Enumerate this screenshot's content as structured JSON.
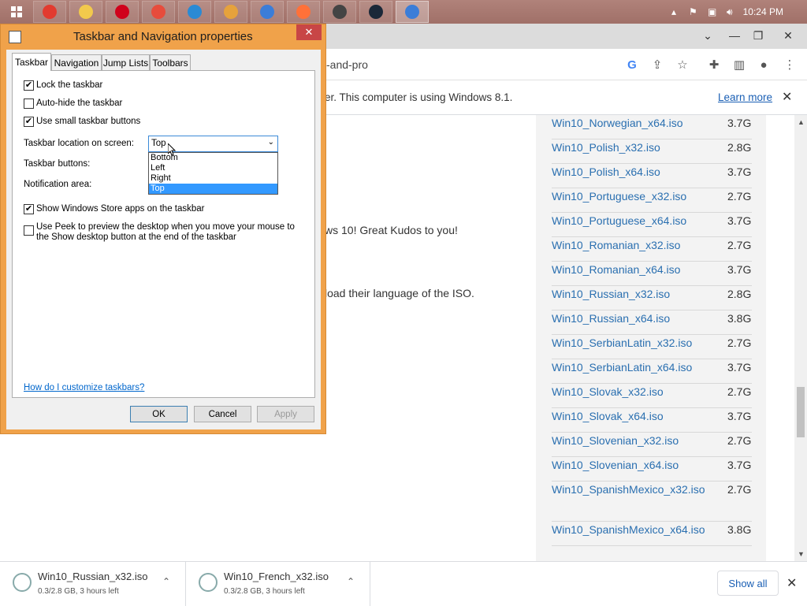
{
  "taskbar": {
    "clock": "10:24 PM",
    "apps": [
      {
        "name": "chrome",
        "color": "#e23b2f"
      },
      {
        "name": "file-explorer",
        "color": "#f2c94c"
      },
      {
        "name": "opera",
        "color": "#d0021b"
      },
      {
        "name": "alarm",
        "color": "#e74c3c"
      },
      {
        "name": "vscode",
        "color": "#2a8ad4"
      },
      {
        "name": "app-orange",
        "color": "#e6a23c"
      },
      {
        "name": "qbittorrent",
        "color": "#3b7dd8"
      },
      {
        "name": "firefox",
        "color": "#ff7139"
      },
      {
        "name": "app-dark",
        "color": "#444444"
      },
      {
        "name": "steam",
        "color": "#1b2838"
      },
      {
        "name": "taskbar-properties",
        "color": "#3b7dd8"
      }
    ]
  },
  "browser": {
    "url_fragment": "-and-pro",
    "infobar_text": "er. This computer is using Windows 8.1.",
    "learn_more": "Learn more"
  },
  "page": {
    "text1": "ws 10! Great Kudos to you!",
    "text2": "load their language of the ISO.",
    "isos": [
      {
        "name": "Win10_Norwegian_x64.iso",
        "size": "3.7G"
      },
      {
        "name": "Win10_Polish_x32.iso",
        "size": "2.8G"
      },
      {
        "name": "Win10_Polish_x64.iso",
        "size": "3.7G"
      },
      {
        "name": "Win10_Portuguese_x32.iso",
        "size": "2.7G"
      },
      {
        "name": "Win10_Portuguese_x64.iso",
        "size": "3.7G"
      },
      {
        "name": "Win10_Romanian_x32.iso",
        "size": "2.7G"
      },
      {
        "name": "Win10_Romanian_x64.iso",
        "size": "3.7G"
      },
      {
        "name": "Win10_Russian_x32.iso",
        "size": "2.8G"
      },
      {
        "name": "Win10_Russian_x64.iso",
        "size": "3.8G"
      },
      {
        "name": "Win10_SerbianLatin_x32.iso",
        "size": "2.7G"
      },
      {
        "name": "Win10_SerbianLatin_x64.iso",
        "size": "3.7G"
      },
      {
        "name": "Win10_Slovak_x32.iso",
        "size": "2.7G"
      },
      {
        "name": "Win10_Slovak_x64.iso",
        "size": "3.7G"
      },
      {
        "name": "Win10_Slovenian_x32.iso",
        "size": "2.7G"
      },
      {
        "name": "Win10_Slovenian_x64.iso",
        "size": "3.7G"
      },
      {
        "name": "Win10_SpanishMexico_x32.iso",
        "size": "2.7G"
      },
      {
        "name": "Win10_SpanishMexico_x64.iso",
        "size": "3.8G"
      }
    ]
  },
  "downloads": {
    "items": [
      {
        "name": "Win10_Russian_x32.iso",
        "status": "0.3/2.8 GB, 3 hours left"
      },
      {
        "name": "Win10_French_x32.iso",
        "status": "0.3/2.8 GB, 3 hours left"
      }
    ],
    "show_all": "Show all"
  },
  "dialog": {
    "title": "Taskbar and Navigation properties",
    "tabs": [
      "Taskbar",
      "Navigation",
      "Jump Lists",
      "Toolbars"
    ],
    "checkboxes": {
      "lock": {
        "label": "Lock the taskbar",
        "checked": true
      },
      "autohide": {
        "label": "Auto-hide the taskbar",
        "checked": false
      },
      "small": {
        "label": "Use small taskbar buttons",
        "checked": true
      },
      "store": {
        "label": "Show Windows Store apps on the taskbar",
        "checked": true
      },
      "peek": {
        "label": "Use Peek to preview the desktop when you move your mouse to the Show desktop button at the end of the taskbar",
        "checked": false
      }
    },
    "location_label": "Taskbar location on screen:",
    "location_value": "Top",
    "location_options": [
      "Bottom",
      "Left",
      "Right",
      "Top"
    ],
    "buttons_label": "Taskbar buttons:",
    "notification_label": "Notification area:",
    "help_link": "How do I customize taskbars?",
    "ok": "OK",
    "cancel": "Cancel",
    "apply": "Apply"
  }
}
